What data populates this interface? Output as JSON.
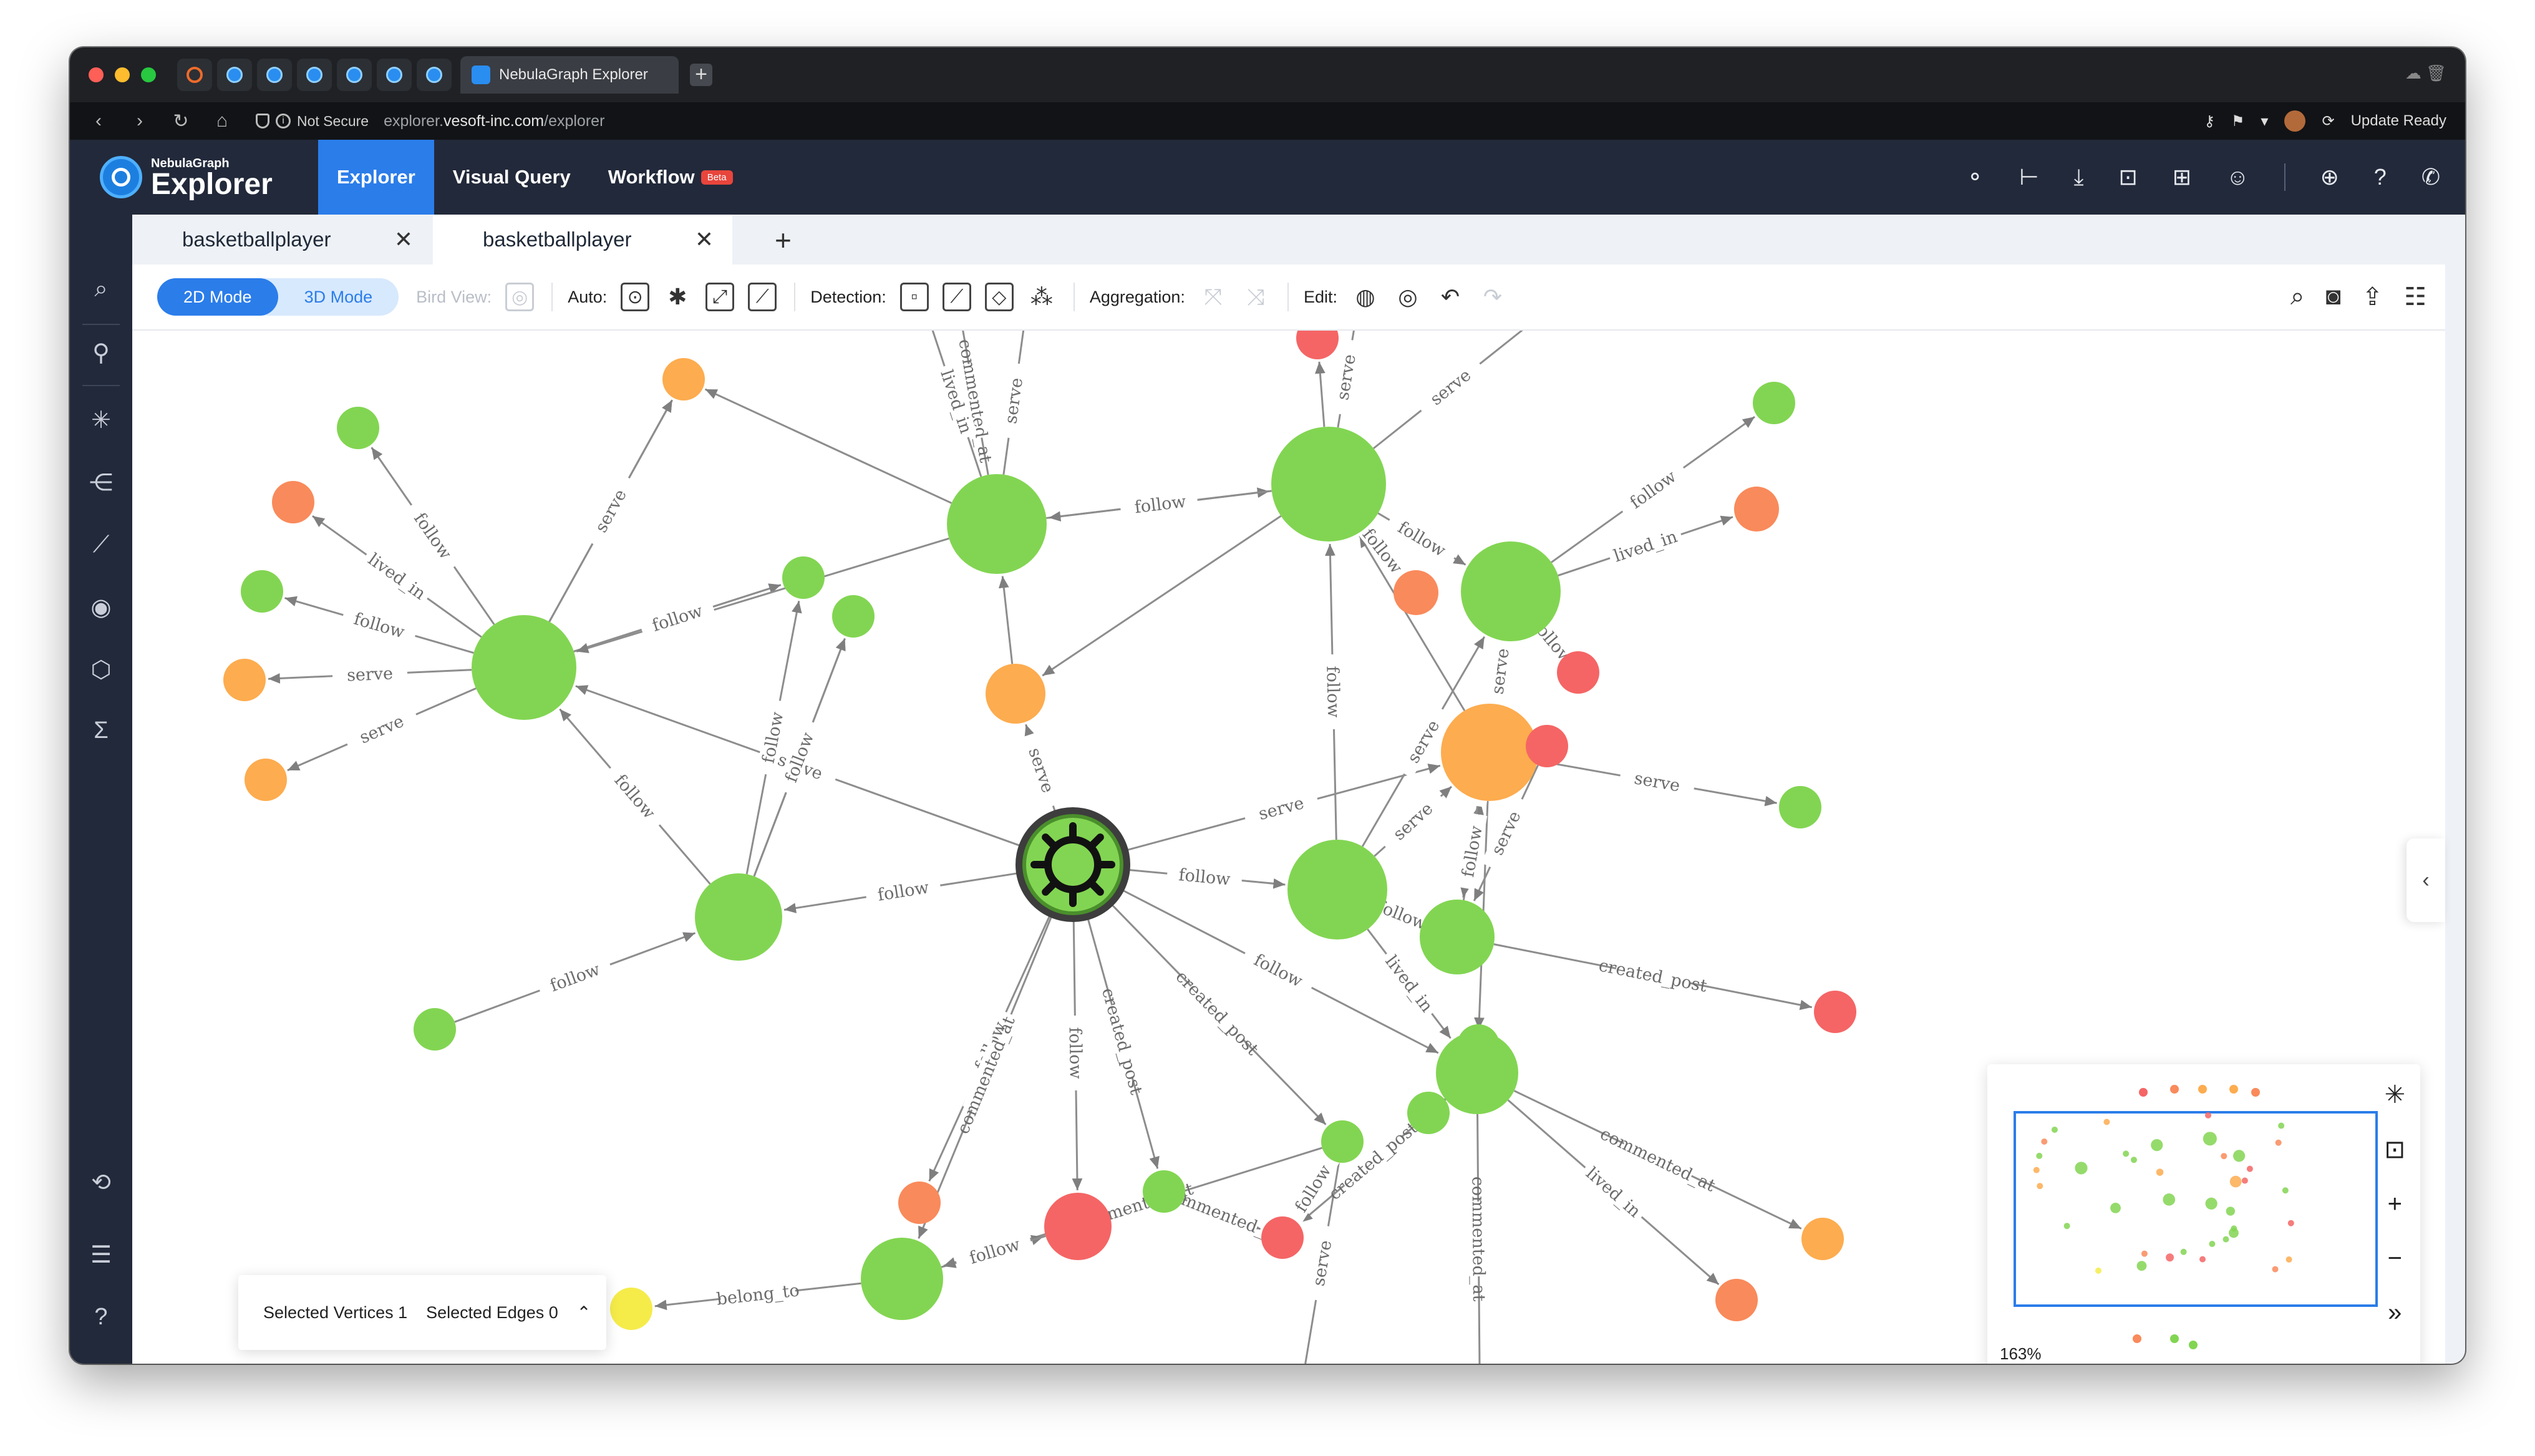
{
  "browser": {
    "tab_title": "NebulaGraph Explorer",
    "security_label": "Not Secure",
    "url_prefix": "explorer.",
    "url_host": "vesoft-inc.com",
    "url_path": "/explorer",
    "update_label": "Update Ready"
  },
  "app": {
    "logo_small": "NebulaGraph",
    "logo_big": "Explorer",
    "nav": [
      {
        "label": "Explorer",
        "active": true
      },
      {
        "label": "Visual Query",
        "active": false
      },
      {
        "label": "Workflow",
        "active": false
      }
    ],
    "beta_badge": "Beta"
  },
  "tabs": [
    {
      "label": "basketballplayer",
      "active": false
    },
    {
      "label": "basketballplayer",
      "active": true
    }
  ],
  "toolbar": {
    "mode_2d": "2D Mode",
    "mode_3d": "3D Mode",
    "bird_view": "Bird View:",
    "auto": "Auto:",
    "detection": "Detection:",
    "aggregation": "Aggregation:",
    "edit": "Edit:"
  },
  "selection": {
    "vertices": "Selected Vertices 1",
    "edges": "Selected Edges 0"
  },
  "minimap": {
    "zoom": "163%"
  },
  "colors": {
    "accent": "#2b7de9",
    "header_bg": "#22293a",
    "vertex_green": "#82d552",
    "vertex_orange": "#fdac4f",
    "vertex_red": "#f56565",
    "vertex_salmon": "#f98a5b",
    "vertex_yellow": "#f5ec4a",
    "edge": "#8a8a8a"
  },
  "graph": {
    "edge_labels": [
      "commented_at",
      "lived_in",
      "serve",
      "serve",
      "serve",
      "commented_at",
      "created_post",
      "serve",
      "follow",
      "serve",
      "follow",
      "lived_in",
      "follow",
      "follow",
      "follow",
      "serve",
      "serve",
      "serve",
      "follow",
      "follow",
      "follow",
      "serve",
      "follow",
      "serve",
      "follow",
      "follow",
      "follow",
      "follow",
      "serve",
      "serve",
      "follow",
      "follow",
      "follow",
      "follow",
      "serve",
      "follow",
      "follow",
      "follow",
      "follow",
      "serve",
      "lived_in",
      "serve",
      "created_post",
      "follow",
      "serve",
      "follow",
      "lived_in",
      "follow",
      "commented_at",
      "follow",
      "created_post",
      "commented_at",
      "follow",
      "commented_at",
      "created_post",
      "serve",
      "lived_in",
      "commented_at",
      "follow",
      "follow",
      "belong_to",
      "commented_at",
      "commented_at",
      "follow",
      "follow",
      "follow",
      "comm",
      "serve",
      "sc"
    ]
  }
}
